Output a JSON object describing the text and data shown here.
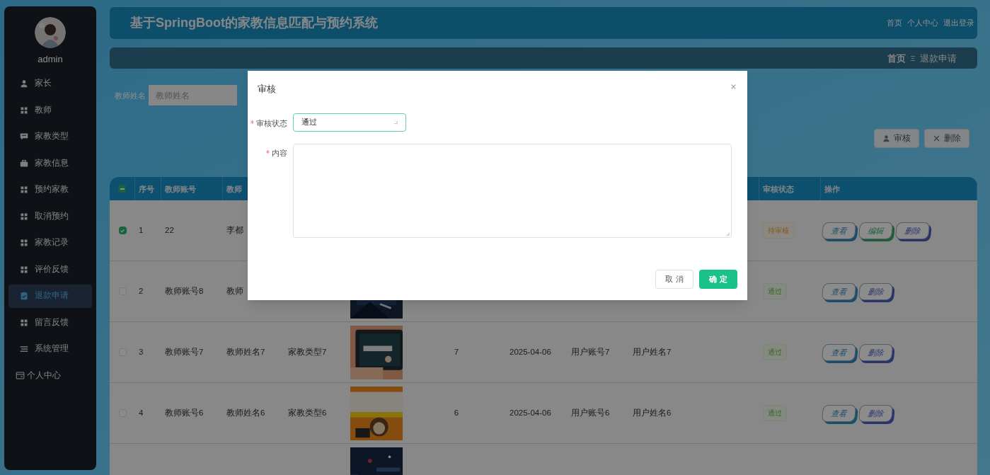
{
  "sidebar": {
    "user": {
      "name": "admin",
      "avatar": {
        "kind": "picture"
      }
    },
    "items": [
      {
        "label": "家长",
        "selected": false
      },
      {
        "label": "教师",
        "selected": false
      },
      {
        "label": "家教类型",
        "selected": false
      },
      {
        "label": "家教信息",
        "selected": false
      },
      {
        "label": "预约家教",
        "selected": false
      },
      {
        "label": "取消预约",
        "selected": false
      },
      {
        "label": "家教记录",
        "selected": false
      },
      {
        "label": "评价反馈",
        "selected": false
      },
      {
        "label": "退款申请",
        "selected": true
      },
      {
        "label": "留言反馈",
        "selected": false
      },
      {
        "label": "系统管理",
        "selected": false
      },
      {
        "label": "个人中心",
        "selected": false
      }
    ]
  },
  "header": {
    "title": "基于SpringBoot的家教信息匹配与预约系统",
    "links": [
      "首页",
      "个人中心",
      "退出登录"
    ]
  },
  "breadcrumb": {
    "home": "首页",
    "current": "退款申请"
  },
  "search": {
    "fields": [
      {
        "label": "教师姓名",
        "placeholder": "教师姓名"
      }
    ]
  },
  "toolbar": {
    "buttons": [
      {
        "label": "审核"
      },
      {
        "label": "删除"
      }
    ]
  },
  "table": {
    "header_checkbox": {
      "indeterminate": true
    },
    "columns": [
      {
        "label": "序号"
      },
      {
        "label": "教师账号"
      },
      {
        "label": "教师"
      },
      {},
      {},
      {},
      {},
      {},
      {},
      {
        "label": "审核状态"
      },
      {
        "label": "操作"
      }
    ],
    "rows": [
      {
        "checked": true,
        "cells": [
          "1",
          "22",
          "李都",
          null,
          null,
          null,
          null,
          null,
          null
        ],
        "status": {
          "text": "待审核",
          "kind": "pending"
        },
        "actions": [
          {
            "label": "查看",
            "kind": "view"
          },
          {
            "label": "编辑",
            "kind": "edit"
          },
          {
            "label": "删除",
            "kind": "delete"
          }
        ]
      },
      {
        "checked": false,
        "cells": [
          "2",
          "教师账号8",
          "教师",
          null,
          {
            "kind": "picture"
          },
          null,
          null,
          null,
          null
        ],
        "status": {
          "text": "通过",
          "kind": "approved"
        },
        "actions": [
          {
            "label": "查看",
            "kind": "view"
          },
          {
            "label": "删除",
            "kind": "delete"
          }
        ]
      },
      {
        "checked": false,
        "cells": [
          "3",
          "教师账号7",
          "教师姓名7",
          "家教类型7",
          {
            "kind": "picture"
          },
          "7",
          "2025-04-06",
          "用户账号7",
          "用户姓名7"
        ],
        "status": {
          "text": "通过",
          "kind": "approved"
        },
        "actions": [
          {
            "label": "查看",
            "kind": "view"
          },
          {
            "label": "删除",
            "kind": "delete"
          }
        ]
      },
      {
        "checked": false,
        "cells": [
          "4",
          "教师账号6",
          "教师姓名6",
          "家教类型6",
          {
            "kind": "picture"
          },
          "6",
          "2025-04-06",
          "用户账号6",
          "用户姓名6"
        ],
        "status": {
          "text": "通过",
          "kind": "approved"
        },
        "actions": [
          {
            "label": "查看",
            "kind": "view"
          },
          {
            "label": "删除",
            "kind": "delete"
          }
        ]
      },
      {
        "cells": [
          null,
          null,
          null,
          null,
          {
            "kind": "picture"
          },
          null,
          null,
          null,
          null
        ]
      }
    ]
  },
  "dialog": {
    "title": "审核",
    "fields": [
      {
        "kind": "select",
        "label": "审核状态",
        "required": true,
        "value": "通过"
      },
      {
        "kind": "textarea",
        "label": "内容",
        "required": true
      }
    ],
    "buttons": [
      {
        "label": "取 消",
        "primary": false
      },
      {
        "label": "确 定",
        "primary": true
      }
    ]
  }
}
